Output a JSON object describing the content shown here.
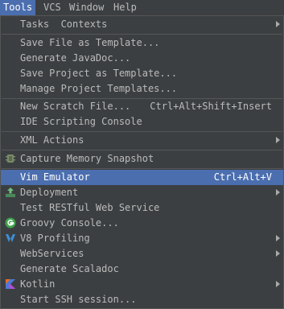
{
  "menubar": {
    "items": [
      "Tools",
      "VCS",
      "Window",
      "Help"
    ]
  },
  "menu": {
    "items": [
      {
        "label": "Tasks  Contexts",
        "submenu": true
      },
      {
        "label": "Save File as Template..."
      },
      {
        "label": "Generate JavaDoc..."
      },
      {
        "label": "Save Project as Template..."
      },
      {
        "label": "Manage Project Templates..."
      },
      {
        "label": "New Scratch File...",
        "shortcut": "Ctrl+Alt+Shift+Insert"
      },
      {
        "label": "IDE Scripting Console"
      },
      {
        "label": "XML Actions",
        "submenu": true
      },
      {
        "label": "Capture Memory Snapshot",
        "icon": "memory-snapshot-icon"
      },
      {
        "label": "Vim Emulator",
        "shortcut": "Ctrl+Alt+V",
        "highlighted": true
      },
      {
        "label": "Deployment",
        "icon": "deployment-icon",
        "submenu": true
      },
      {
        "label": "Test RESTful Web Service"
      },
      {
        "label": "Groovy Console...",
        "icon": "groovy-icon"
      },
      {
        "label": "V8 Profiling",
        "icon": "v8-profiling-icon",
        "submenu": true
      },
      {
        "label": "WebServices",
        "submenu": true
      },
      {
        "label": "Generate Scaladoc"
      },
      {
        "label": "Kotlin",
        "icon": "kotlin-icon",
        "submenu": true
      },
      {
        "label": "Start SSH session..."
      }
    ]
  },
  "colors": {
    "background": "#3c3f41",
    "highlight": "#4b6eaf",
    "text": "#bbbbbb",
    "separator": "#555555"
  }
}
